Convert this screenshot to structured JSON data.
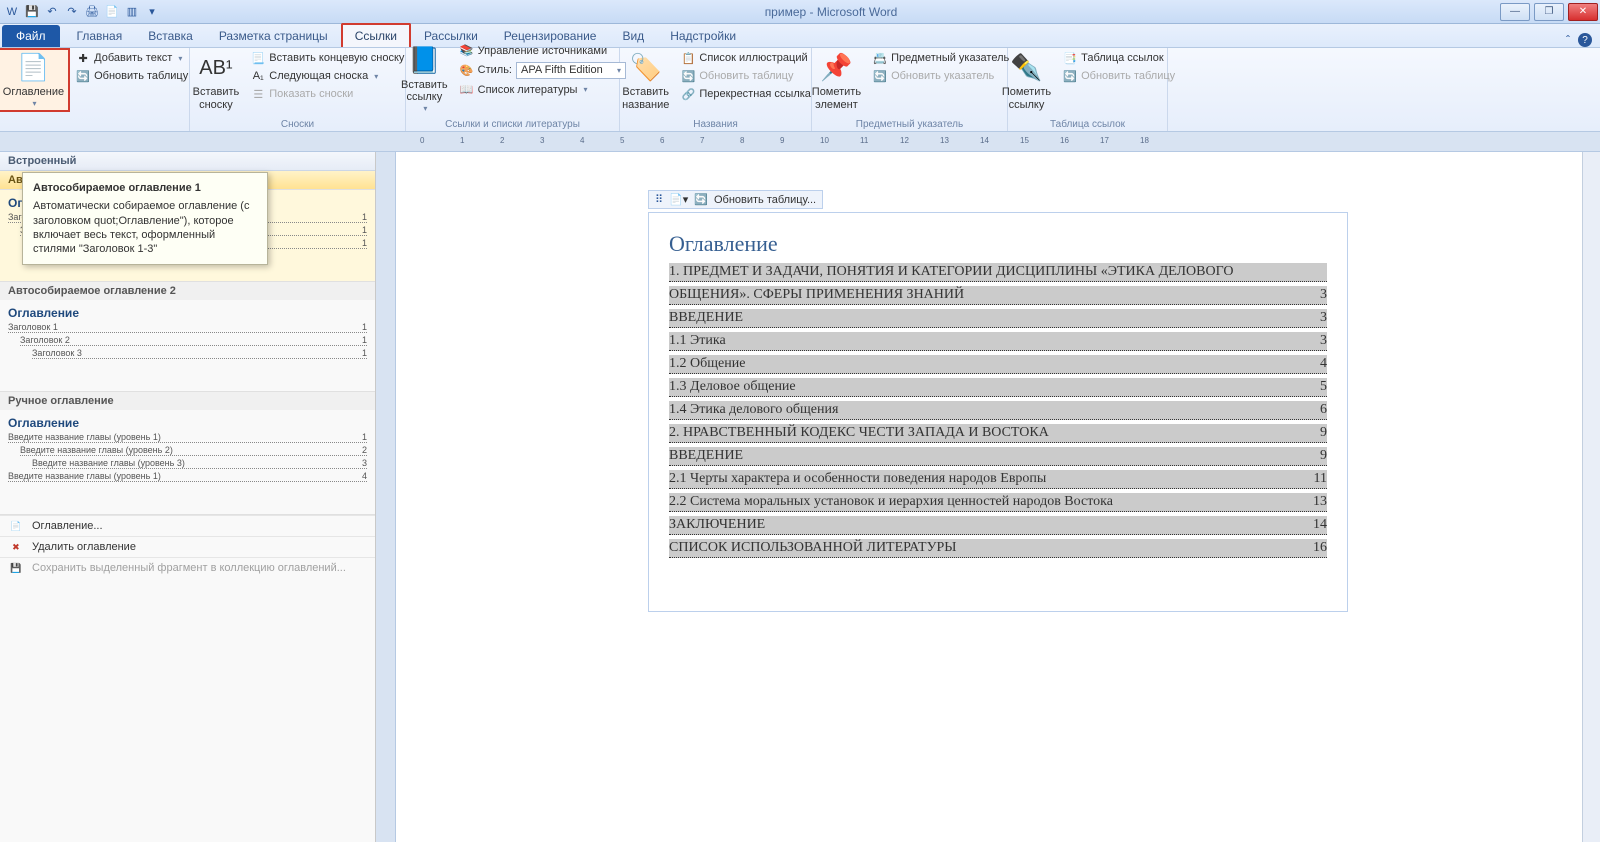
{
  "window": {
    "title": "пример - Microsoft Word"
  },
  "qat": {
    "save": "💾",
    "undo": "↶",
    "redo": "↷",
    "print": "🖨",
    "preview": "📄",
    "table": "▥"
  },
  "tabs": {
    "file": "Файл",
    "home": "Главная",
    "insert": "Вставка",
    "layout": "Разметка страницы",
    "references": "Ссылки",
    "mailings": "Рассылки",
    "review": "Рецензирование",
    "view": "Вид",
    "addins": "Надстройки"
  },
  "ribbon": {
    "toc": {
      "button": "Оглавление",
      "add_text": "Добавить текст",
      "update": "Обновить таблицу",
      "group": ""
    },
    "footnotes": {
      "insert_footnote": "Вставить сноску",
      "insert_endnote": "Вставить концевую сноску",
      "next_footnote": "Следующая сноска",
      "show_notes": "Показать сноски",
      "group": "Сноски"
    },
    "citations": {
      "insert_citation": "Вставить ссылку",
      "manage_sources": "Управление источниками",
      "style_label": "Стиль:",
      "style_value": "APA Fifth Edition",
      "bibliography": "Список литературы",
      "group": "Ссылки и списки литературы"
    },
    "captions": {
      "insert_caption": "Вставить название",
      "table_of_figures": "Список иллюстраций",
      "update_table": "Обновить таблицу",
      "cross_reference": "Перекрестная ссылка",
      "group": "Названия"
    },
    "index": {
      "mark_entry": "Пометить элемент",
      "insert_index": "Предметный указатель",
      "update_index": "Обновить указатель",
      "group": "Предметный указатель"
    },
    "authorities": {
      "mark_citation": "Пометить ссылку",
      "insert_toa": "Таблица ссылок",
      "update_toa": "Обновить таблицу",
      "group": "Таблица ссылок"
    }
  },
  "gallery": {
    "header_builtin": "Встроенный",
    "auto1_title": "Автособираемое оглавление 1",
    "auto2_title": "Автособираемое оглавление 2",
    "preview_title": "Оглавление",
    "h1": "Заголовок 1",
    "h2": "Заголовок 2",
    "h3": "Заголовок 3",
    "manual_header": "Ручное оглавление",
    "manual_l1": "Введите название главы (уровень 1)",
    "manual_l2": "Введите название главы (уровень 2)",
    "manual_l3": "Введите название главы (уровень 3)",
    "manual_l1b": "Введите название главы (уровень 1)",
    "p1": "1",
    "p3": "3",
    "p4": "4",
    "cmd_insert": "Оглавление...",
    "cmd_remove": "Удалить оглавление",
    "cmd_save": "Сохранить выделенный фрагмент в коллекцию оглавлений..."
  },
  "tooltip": {
    "title": "Автособираемое оглавление 1",
    "body": "Автоматически собираемое оглавление (с заголовком quot;Оглавление\"), которое включает весь текст, оформленный стилями \"Заголовок 1-3\""
  },
  "tocbar": {
    "update": "Обновить таблицу..."
  },
  "document": {
    "title": "Оглавление",
    "lines": [
      {
        "t": "1.    ПРЕДМЕТ И ЗАДАЧИ, ПОНЯТИЯ И КАТЕГОРИИ ДИСЦИПЛИНЫ «ЭТИКА ДЕЛОВОГО",
        "p": ""
      },
      {
        "t": "ОБЩЕНИЯ». СФЕРЫ ПРИМЕНЕНИЯ ЗНАНИЙ",
        "p": "3"
      },
      {
        "t": "ВВЕДЕНИЕ",
        "p": "3"
      },
      {
        "t": "1.1 Этика",
        "p": "3"
      },
      {
        "t": "1.2 Общение",
        "p": "4"
      },
      {
        "t": "1.3 Деловое общение",
        "p": "5"
      },
      {
        "t": "1.4 Этика делового общения",
        "p": "6"
      },
      {
        "t": "2.    НРАВСТВЕННЫЙ КОДЕКС ЧЕСТИ ЗАПАДА И ВОСТОКА",
        "p": "9"
      },
      {
        "t": "ВВЕДЕНИЕ",
        "p": "9"
      },
      {
        "t": "2.1 Черты характера и особенности поведения народов Европы",
        "p": "11"
      },
      {
        "t": "2.2 Система моральных установок и иерархия ценностей народов Востока",
        "p": "13"
      },
      {
        "t": "ЗАКЛЮЧЕНИЕ",
        "p": "14"
      },
      {
        "t": "СПИСОК ИСПОЛЬЗОВАННОЙ ЛИТЕРАТУРЫ",
        "p": "16"
      }
    ]
  }
}
